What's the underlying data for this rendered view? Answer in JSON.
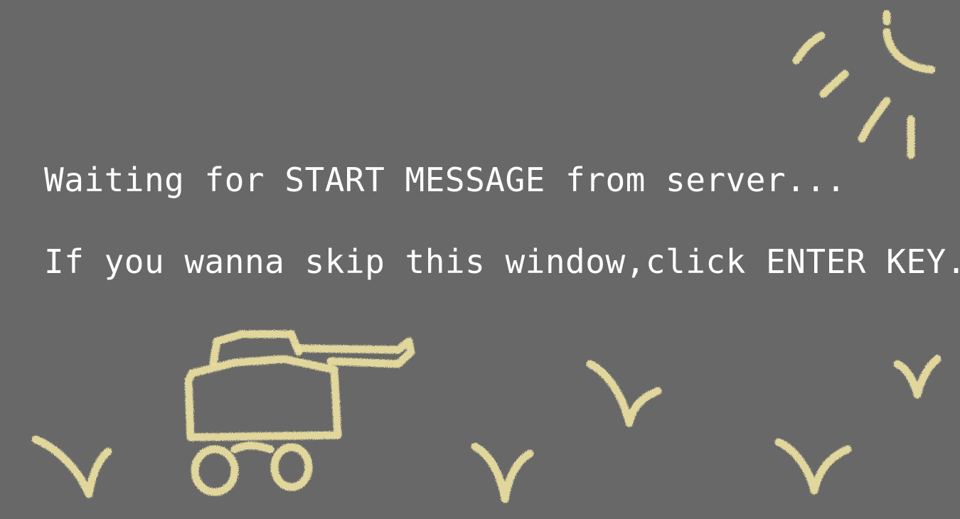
{
  "screen": {
    "background_color": "#686868",
    "text_color": "#ffffff",
    "chalk_color": "#e8dda0"
  },
  "messages": {
    "waiting": "Waiting for START MESSAGE from server...",
    "skip_hint": "If you wanna skip this window,click ENTER KEY."
  },
  "doodles": [
    "sun-icon",
    "tank-icon",
    "sprout-icon",
    "sprout-icon",
    "sprout-icon",
    "sprout-icon",
    "sprout-icon"
  ]
}
